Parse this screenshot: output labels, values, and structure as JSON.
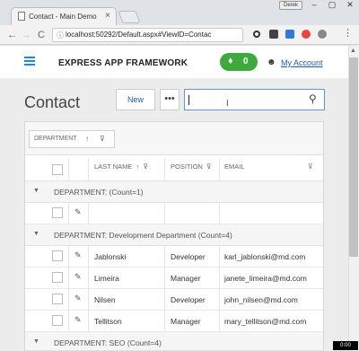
{
  "browser": {
    "tab_title": "Contact - Main Demo",
    "tab_close": "×",
    "profile": "Derek",
    "url": "localhost:50292/Default.aspx#ViewID=Contac",
    "win_min": "–",
    "win_max": "▢",
    "win_close": "✕",
    "back": "←",
    "forward": "→",
    "reload": "C",
    "star": "☆"
  },
  "app": {
    "brand": "EXPRESS APP FRAMEWORK",
    "notification_count": "0",
    "bell": "🔔",
    "account": "My Account",
    "avatar": "👤"
  },
  "toolbar": {
    "title": "Contact",
    "new_label": "New",
    "more_label": "•••",
    "search_value": "",
    "search_icon": "⚲"
  },
  "grid": {
    "group_panel": {
      "field": "DEPARTMENT",
      "sort": "↑",
      "filter": "⊽"
    },
    "columns": [
      {
        "label": "LAST NAME",
        "sort": "↑",
        "filter": "⊽"
      },
      {
        "label": "POSITION",
        "filter": "⊽"
      },
      {
        "label": "EMAIL",
        "filter": "⊽"
      }
    ],
    "groups": [
      {
        "label": "DEPARTMENT: (Count=1)",
        "rows": [
          {
            "last_name": "",
            "position": "",
            "email": ""
          }
        ]
      },
      {
        "label": "DEPARTMENT: Development Department (Count=4)",
        "rows": [
          {
            "last_name": "Jablonski",
            "position": "Developer",
            "email": "karl_jablonski@md.com"
          },
          {
            "last_name": "Limeira",
            "position": "Manager",
            "email": "janete_limeira@md.com"
          },
          {
            "last_name": "Nilsen",
            "position": "Developer",
            "email": "john_nilsen@md.com"
          },
          {
            "last_name": "Tellitson",
            "position": "Manager",
            "email": "mary_tellitson@md.com"
          }
        ]
      },
      {
        "label": "DEPARTMENT: SEO (Count=4)",
        "rows": []
      }
    ],
    "pencil_icon": "✎",
    "expand_icon": "▼"
  },
  "timer": "0:00",
  "colors": {
    "accent": "#1e88e5",
    "bell_green": "#3caa3c",
    "link": "#1e5ea8"
  }
}
